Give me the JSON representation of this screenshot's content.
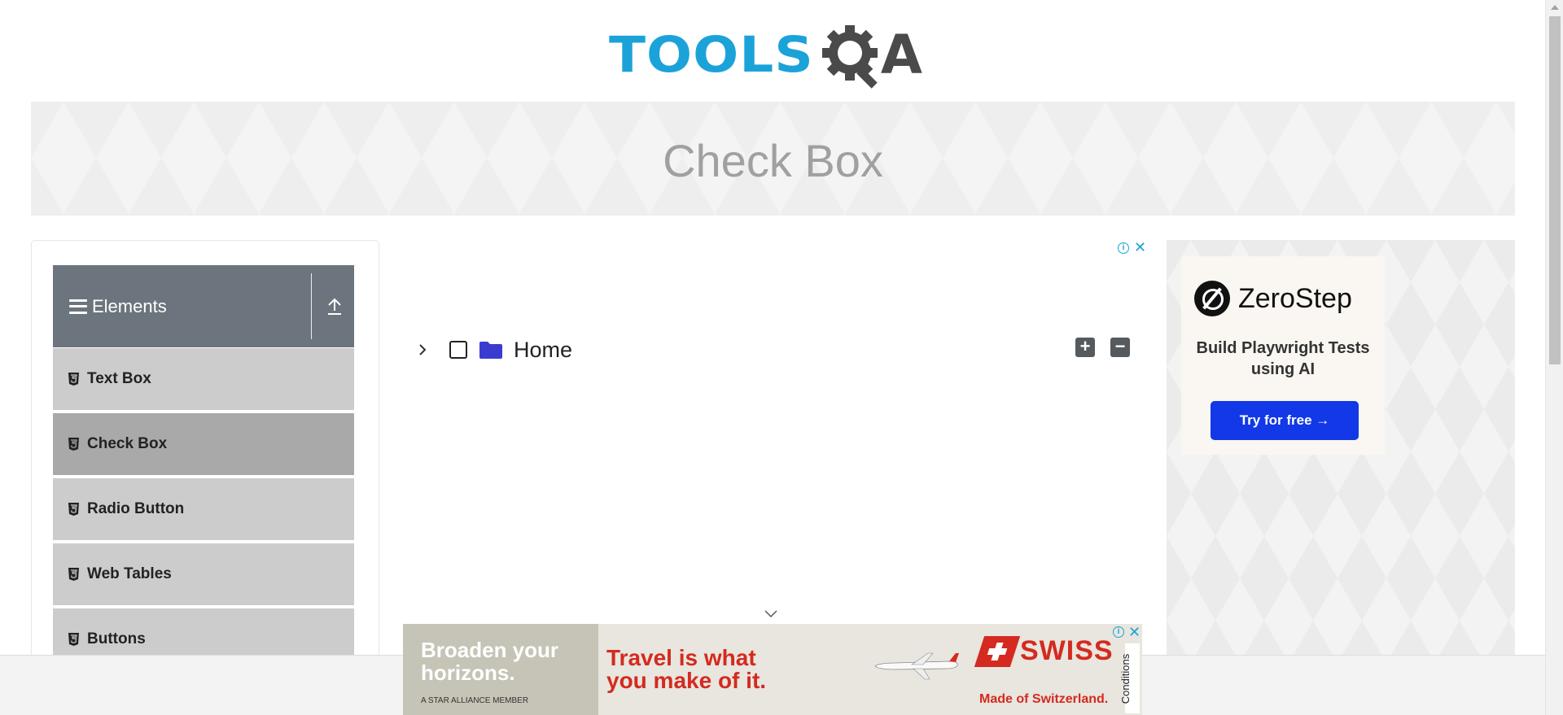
{
  "header": {
    "logo_tools": "TOOLS",
    "logo_a": "A",
    "page_title": "Check Box"
  },
  "sidebar": {
    "group_title": "Elements",
    "items": [
      {
        "label": "Text Box",
        "active": false
      },
      {
        "label": "Check Box",
        "active": true
      },
      {
        "label": "Radio Button",
        "active": false
      },
      {
        "label": "Web Tables",
        "active": false
      },
      {
        "label": "Buttons",
        "active": false
      }
    ]
  },
  "tree": {
    "root_label": "Home",
    "expanded": false,
    "checked": false,
    "expand_all_symbol": "+",
    "collapse_all_symbol": "−"
  },
  "right_ad": {
    "brand": "ZeroStep",
    "tagline": "Build Playwright Tests using AI",
    "cta": "Try for free →"
  },
  "bottom_ad": {
    "headline": "Broaden your horizons.",
    "alliance": "A STAR ALLIANCE MEMBER",
    "slogan": "Travel is what you make of it.",
    "brand": "SWISS",
    "subtitle": "Made of Switzerland.",
    "conditions": "Conditions"
  },
  "icons": {
    "menu": "hamburger-icon",
    "collapse": "upload-arrow-icon",
    "item": "html5-icon",
    "expand": "chevron-right-icon",
    "folder": "folder-icon",
    "ad_info": "info-icon",
    "ad_close": "close-icon"
  },
  "colors": {
    "brand_blue": "#1ba3d9",
    "sidebar_header": "#6c757d",
    "menu_item": "#cccccc",
    "menu_item_active": "#a9a9a9",
    "folder": "#3b3bd0",
    "cta": "#1238e8",
    "swiss_red": "#d42a20"
  }
}
